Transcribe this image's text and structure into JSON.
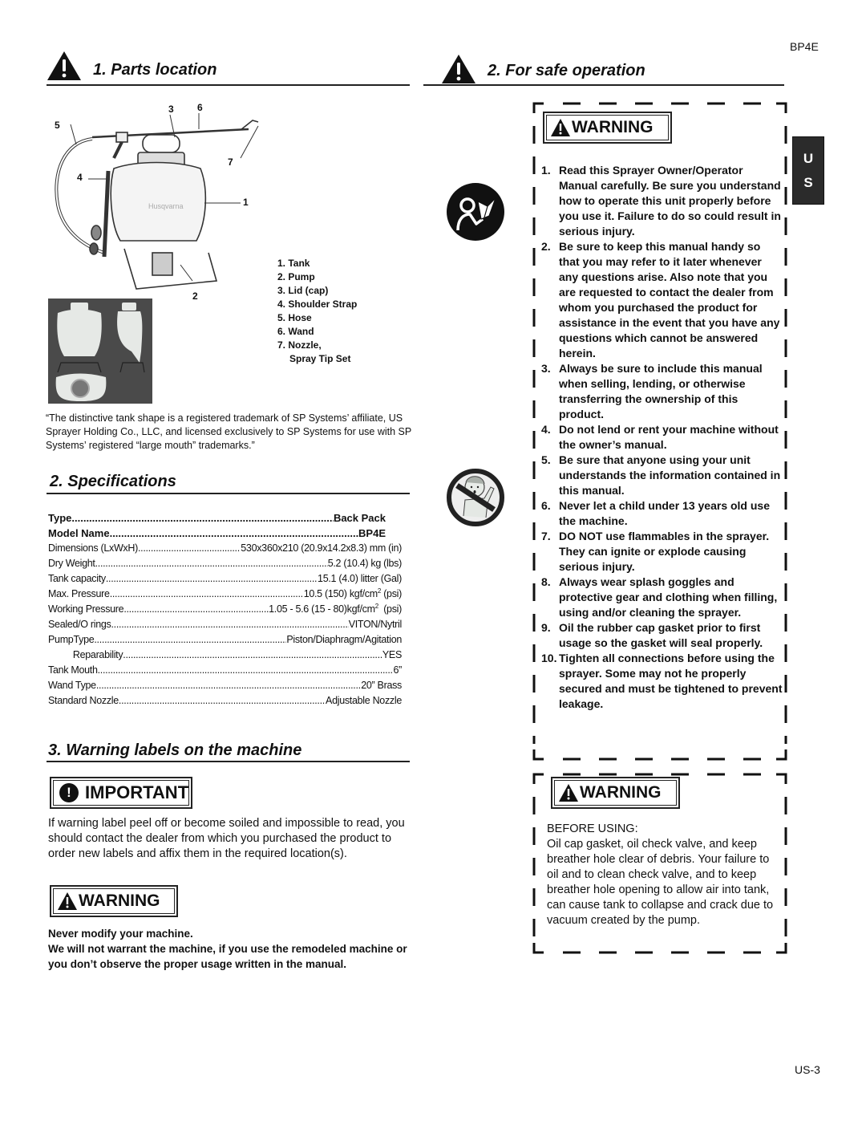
{
  "page": {
    "model_header": "BP4E",
    "page_number": "US-3",
    "language_tab": [
      "U",
      "S"
    ]
  },
  "parts_location": {
    "title": "1. Parts location",
    "callouts": [
      "1",
      "2",
      "3",
      "4",
      "5",
      "6",
      "7"
    ],
    "brand_mark": "Husqvarna",
    "parts": [
      "1. Tank",
      "2. Pump",
      "3. Lid (cap)",
      "4. Shoulder Strap",
      "5. Hose",
      "6. Wand",
      "7. Nozzle,"
    ],
    "parts_continuation": "Spray Tip Set",
    "trademark_note": "“The distinctive tank shape is a registered trademark of SP Systems’ affiliate, US Sprayer Holding Co., LLC, and licensed exclusively to SP Systems for use with SP Systems’ registered “large mouth” trademarks.”"
  },
  "specifications": {
    "title": "2. Specifications",
    "rows": [
      {
        "label": "Type ",
        "value": " Back Pack",
        "bold": true
      },
      {
        "label": "Model Name",
        "value": " BP4E",
        "bold": true
      },
      {
        "label": "Dimensions (LxWxH)",
        "value": " 530x360x210 (20.9x14.2x8.3) mm (in)"
      },
      {
        "label": "Dry Weight",
        "value": " 5.2 (10.4) kg (lbs)"
      },
      {
        "label": "Tank capacity",
        "value": " 15.1 (4.0) litter (Gal)"
      },
      {
        "label": "Max. Pressure",
        "value": "10.5 (150) kgf/cm",
        "sup": "2",
        "suffix": " (psi)"
      },
      {
        "label": "Working Pressure",
        "value": " 1.05 - 5.6 (15 - 80)kgf/cm",
        "sup": "2",
        "suffix": "  (psi)"
      },
      {
        "label": "Sealed/O rings",
        "value": " VITON/Nytril"
      },
      {
        "group": "Pump",
        "label": "Type",
        "value": "Piston/Diaphragm/Agitation"
      },
      {
        "group": "",
        "label": "Reparability",
        "value": " YES"
      },
      {
        "label": "Tank Mouth ",
        "value": " 6”"
      },
      {
        "label": "Wand Type ",
        "value": " 20” Brass"
      },
      {
        "label": "Standard Nozzle ",
        "value": "Adjustable Nozzle"
      }
    ]
  },
  "warning_labels": {
    "title": "3. Warning labels on the machine",
    "important_label": "IMPORTANT",
    "important_text": "If warning label peel off or become soiled and impossible to read, you should contact the dealer from which you purchased the product to order new labels and affix them in the required location(s).",
    "warning_label": "WARNING",
    "never_modify": "Never modify your machine.",
    "warranty_text": "We will not warrant the machine, if you use the remodeled machine or you don’t observe the proper usage written in the manual."
  },
  "safe_operation": {
    "title": "2. For safe operation",
    "warning_label": "WARNING",
    "icons": [
      "read-manual-icon",
      "no-children-icon"
    ],
    "items": [
      {
        "num": "1.",
        "text": "Read this Sprayer Owner/Operator Manual carefully. Be sure you understand how to operate this unit properly before you use it. Failure to do so could result in serious injury."
      },
      {
        "num": "2.",
        "text": "Be sure to keep this manual handy so that you may refer to it later whenever any questions arise. Also note that you are requested to contact the dealer from whom you purchased the product for assistance in the event that you have any questions which cannot be answered herein."
      },
      {
        "num": "3.",
        "text": "Always be sure to include this manual when selling, lending, or otherwise transferring the ownership of this product."
      },
      {
        "num": "4.",
        "text": "Do not lend or rent your machine without the owner’s manual."
      },
      {
        "num": "5.",
        "text": "Be sure that anyone using your unit understands the information contained in this manual."
      },
      {
        "num": "6.",
        "text": "Never let a child under 13 years old use the machine."
      },
      {
        "num": "7.",
        "text": "DO NOT use flammables in the sprayer. They can ignite or explode causing serious injury."
      },
      {
        "num": "8.",
        "text": "Always wear splash goggles and protective gear and clothing when filling, using and/or cleaning the sprayer."
      },
      {
        "num": "9.",
        "text": "Oil the rubber cap gasket prior to first usage so the gasket will seal properly."
      },
      {
        "num": "10.",
        "text": "Tighten all connections before using the sprayer. Some may not he properly secured and must be tightened to prevent leakage."
      }
    ],
    "second_warning_label": "WARNING",
    "before_using_title": "BEFORE USING:",
    "before_using_text": "Oil cap gasket, oil check valve, and keep breather hole clear of debris. Your failure to oil and to clean check valve, and to keep breather hole opening to allow air into tank, can cause tank to collapse and crack due to vacuum created by the pump."
  }
}
